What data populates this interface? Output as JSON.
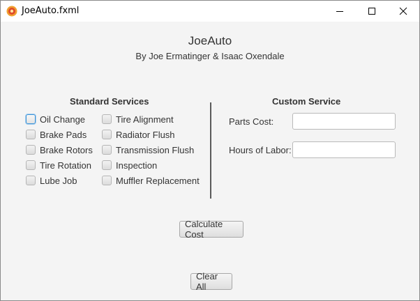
{
  "window": {
    "title": "JoeAuto.fxml",
    "controls": {
      "minimize_icon": "minimize-icon",
      "maximize_icon": "maximize-icon",
      "close_icon": "close-icon"
    }
  },
  "header": {
    "title": "JoeAuto",
    "subtitle": "By Joe Ermatinger & Isaac Oxendale"
  },
  "standard_services": {
    "heading": "Standard Services",
    "left_column": [
      {
        "label": "Oil Change",
        "checked": false,
        "focused": true
      },
      {
        "label": "Brake Pads",
        "checked": false
      },
      {
        "label": "Brake Rotors",
        "checked": false
      },
      {
        "label": "Tire Rotation",
        "checked": false
      },
      {
        "label": "Lube Job",
        "checked": false
      }
    ],
    "right_column": [
      {
        "label": "Tire Alignment",
        "checked": false
      },
      {
        "label": "Radiator Flush",
        "checked": false
      },
      {
        "label": "Transmission Flush",
        "checked": false
      },
      {
        "label": "Inspection",
        "checked": false
      },
      {
        "label": "Muffler Replacement",
        "checked": false
      }
    ]
  },
  "custom_service": {
    "heading": "Custom Service",
    "parts_cost_label": "Parts Cost:",
    "parts_cost_value": "",
    "hours_label": "Hours of Labor:",
    "hours_value": ""
  },
  "actions": {
    "calculate_label": "Calculate Cost",
    "clear_label": "Clear All"
  },
  "colors": {
    "background": "#f4f4f4",
    "focus": "#3b93d6",
    "divider": "#5a5a5a"
  }
}
